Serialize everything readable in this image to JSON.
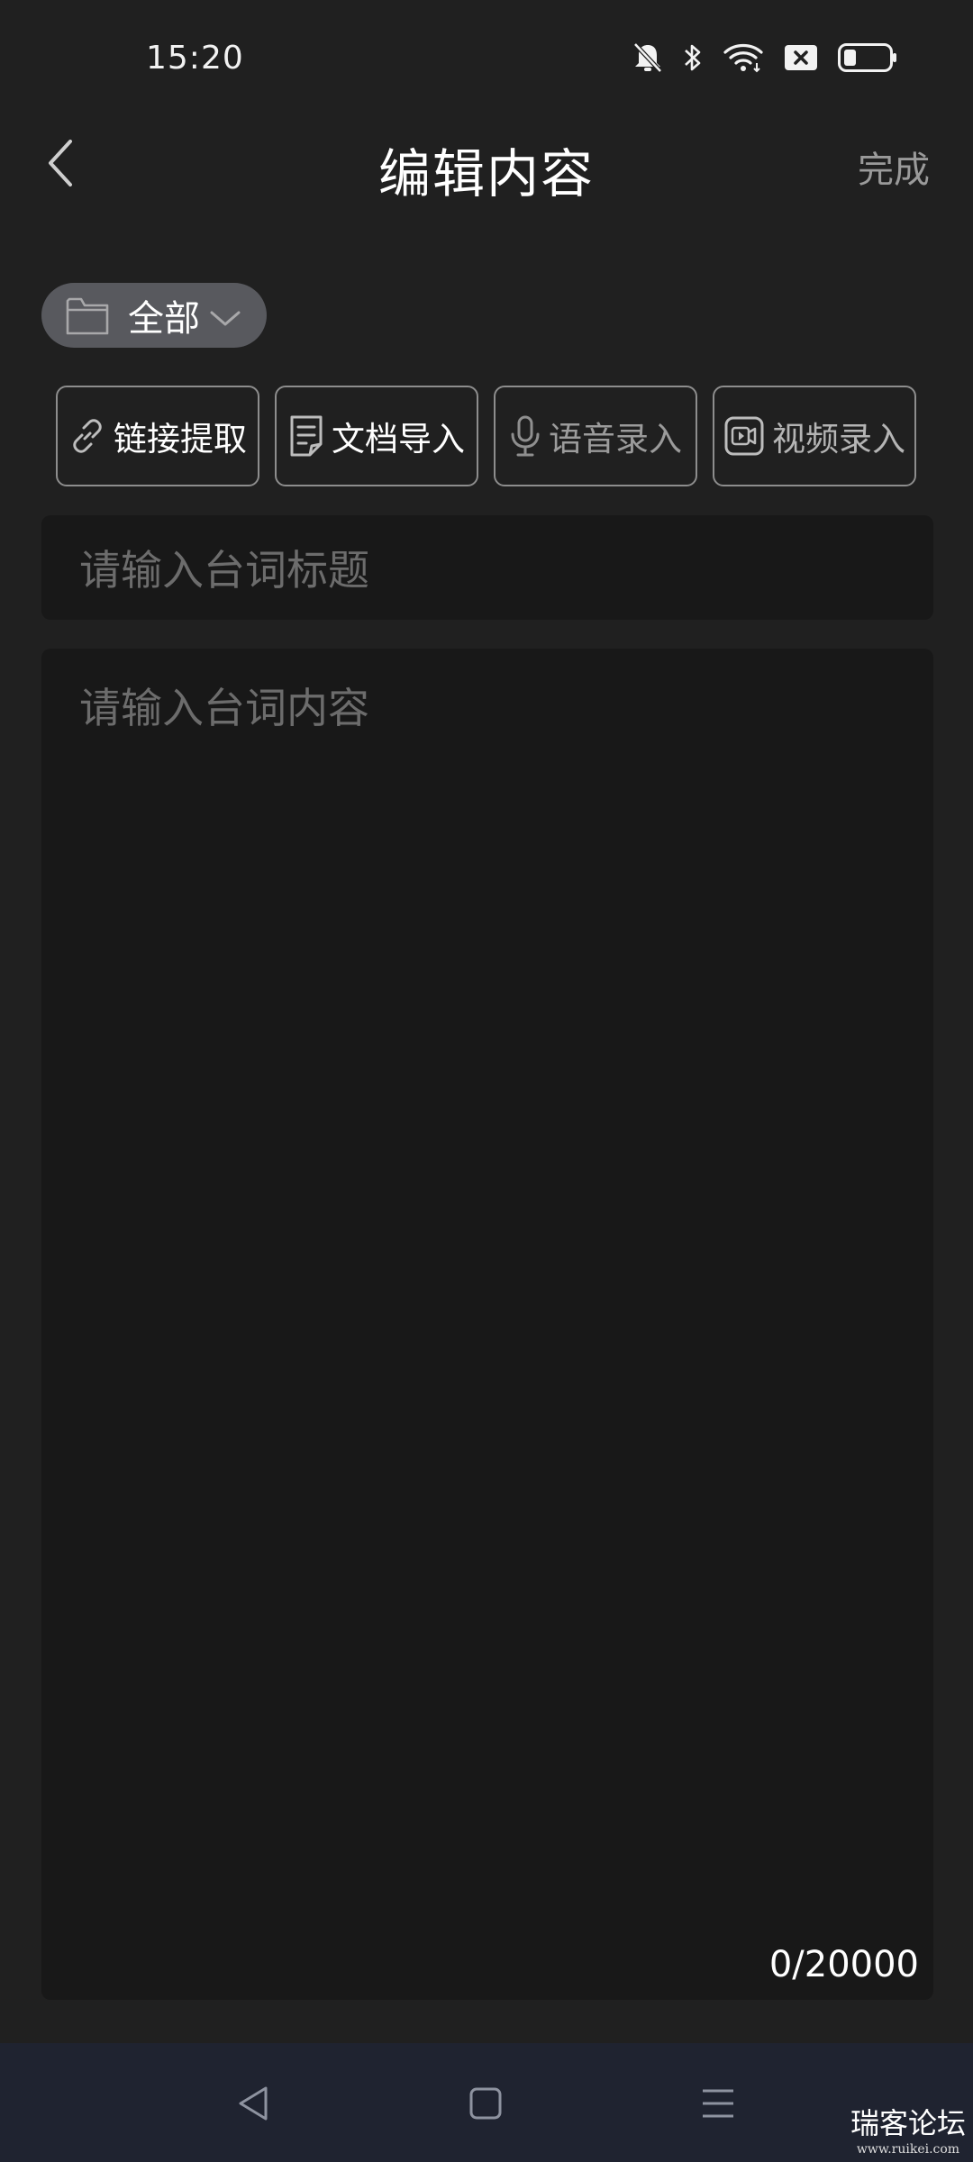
{
  "status_bar": {
    "time": "15:20",
    "icons": [
      "bell-off-icon",
      "bluetooth-icon",
      "wifi-icon",
      "sim-off-icon",
      "battery-icon"
    ]
  },
  "header": {
    "title": "编辑内容",
    "done_label": "完成"
  },
  "category": {
    "label": "全部"
  },
  "actions": [
    {
      "label": "链接提取",
      "icon": "link-icon",
      "enabled": true
    },
    {
      "label": "文档导入",
      "icon": "document-icon",
      "enabled": true
    },
    {
      "label": "语音录入",
      "icon": "microphone-icon",
      "enabled": false
    },
    {
      "label": "视频录入",
      "icon": "video-icon",
      "enabled": true
    }
  ],
  "title_input": {
    "placeholder": "请输入台词标题",
    "value": ""
  },
  "content_input": {
    "placeholder": "请输入台词内容",
    "value": "",
    "char_count": "0/20000"
  },
  "nav_bar": {
    "buttons": [
      "back-triangle-icon",
      "home-square-icon",
      "menu-lines-icon"
    ]
  },
  "watermark": {
    "text": "瑞客论坛",
    "url": "www.ruikei.com"
  },
  "colors": {
    "background": "#202020",
    "input_background": "#181818",
    "nav_background": "#1f2330",
    "pill_background": "#58595e",
    "placeholder": "#6c6c6c"
  }
}
